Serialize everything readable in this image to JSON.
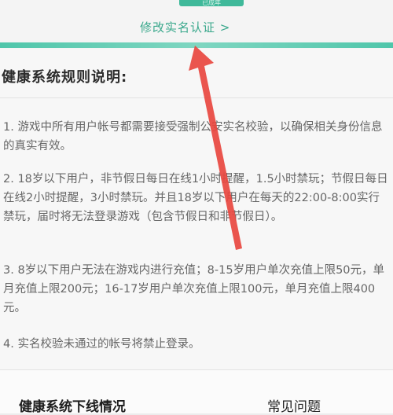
{
  "header": {
    "status_badge": "已成年",
    "modify_link": "修改实名认证 >"
  },
  "rules": {
    "title": "健康系统规则说明:",
    "items": [
      "1. 游戏中所有用户帐号都需要接受强制公安实名校验，以确保相关身份信息的真实有效。",
      "2. 18岁以下用户，非节假日每日在线1小时提醒，1.5小时禁玩；节假日每日在线2小时提醒，3小时禁玩。并且18岁以下用户在每天的22:00-8:00实行禁玩，届时将无法登录游戏（包含节假日和非节假日）。",
      "3. 8岁以下用户无法在游戏内进行充值；8-15岁用户单次充值上限50元，单月充值上限200元；16-17岁用户单次充值上限100元，单月充值上限400元。",
      "4. 实名校验未通过的帐号将禁止登录。"
    ]
  },
  "tabs": {
    "offline": "健康系统下线情况",
    "faq": "常见问题"
  },
  "colors": {
    "accent": "#3fb99a",
    "arrow": "#e8473f"
  }
}
